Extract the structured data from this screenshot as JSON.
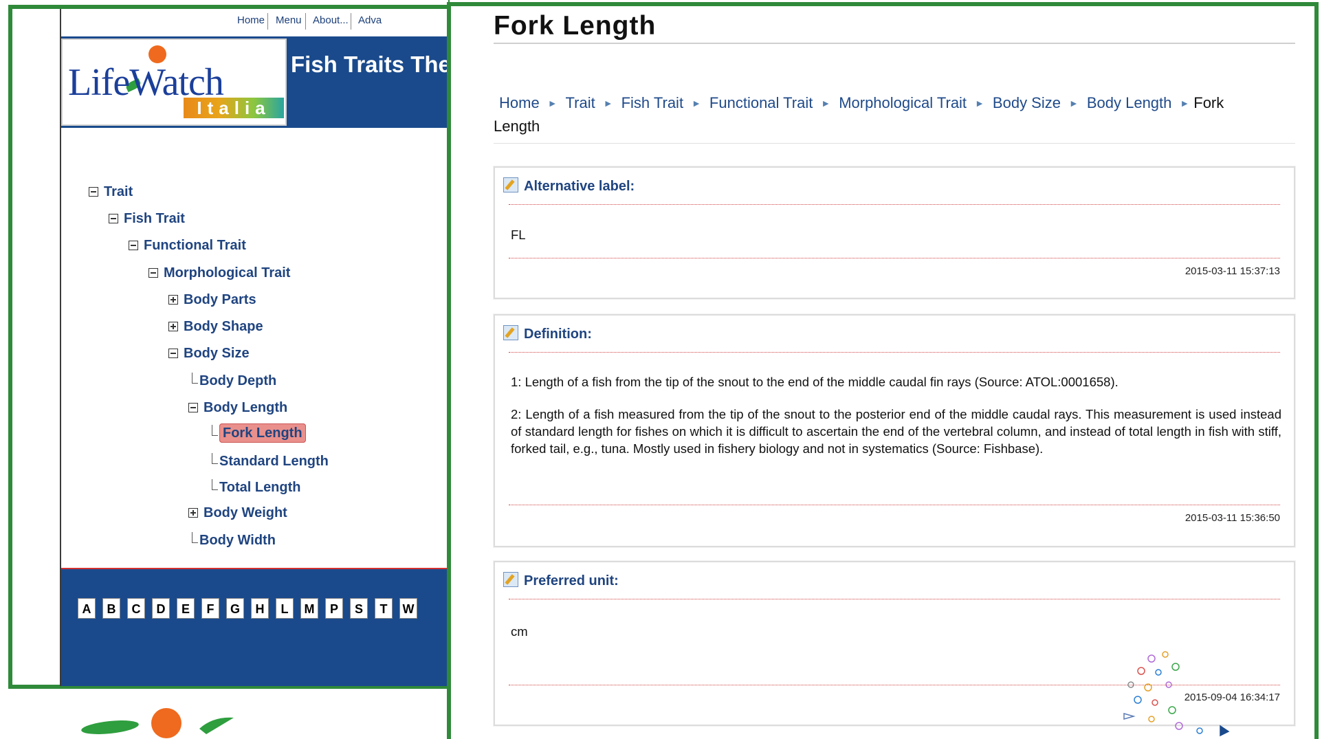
{
  "topnav": {
    "items": [
      "Home",
      "Menu",
      "About...",
      "Adva"
    ]
  },
  "logo": {
    "word": "LifeWatch",
    "sub": "Italia"
  },
  "header": {
    "title": "Fish Traits The"
  },
  "tree": {
    "trait": "Trait",
    "fish_trait": "Fish Trait",
    "functional_trait": "Functional Trait",
    "morphological_trait": "Morphological Trait",
    "body_parts": "Body Parts",
    "body_shape": "Body Shape",
    "body_size": "Body Size",
    "body_depth": "Body Depth",
    "body_length": "Body Length",
    "fork_length": "Fork Length",
    "standard_length": "Standard Length",
    "total_length": "Total Length",
    "body_weight": "Body Weight",
    "body_width": "Body Width"
  },
  "alphabet": [
    "A",
    "B",
    "C",
    "D",
    "E",
    "F",
    "G",
    "H",
    "L",
    "M",
    "P",
    "S",
    "T",
    "W"
  ],
  "page": {
    "title": "Fork Length"
  },
  "breadcrumb": {
    "items": [
      "Home",
      "Trait",
      "Fish Trait",
      "Functional Trait",
      "Morphological Trait",
      "Body Size",
      "Body Length"
    ],
    "current_part1": "Fork",
    "current_part2": "Length"
  },
  "cards": {
    "alt_label": {
      "heading": "Alternative label:",
      "value": "FL",
      "date": "2015-03-11 15:37:13"
    },
    "definition": {
      "heading": "Definition:",
      "p1": "1: Length of a fish from the tip of the snout to the end of the middle caudal fin rays (Source: ATOL:0001658).",
      "p2": "2: Length of a fish measured from the tip of the snout to the posterior end of the middle caudal rays. This measurement is used instead of standard length for fishes on which it is difficult to ascertain the end of the vertebral column, and instead of total length in fish with stiff, forked tail, e.g., tuna. Mostly used in fishery biology and not in systematics (Source: Fishbase).",
      "date": "2015-03-11 15:36:50"
    },
    "preferred_unit": {
      "heading": "Preferred unit:",
      "value": "cm",
      "date": "2015-09-04 16:34:17"
    }
  },
  "icons": {
    "edit": "edit-pencil-icon",
    "expand": "plus-box-icon",
    "collapse": "minus-box-icon"
  },
  "colors": {
    "frame": "#2f8a3a",
    "header_bg": "#1a4a8c",
    "link": "#1f4480",
    "selected_bg": "#e9908c",
    "rule_red": "#d04040"
  }
}
